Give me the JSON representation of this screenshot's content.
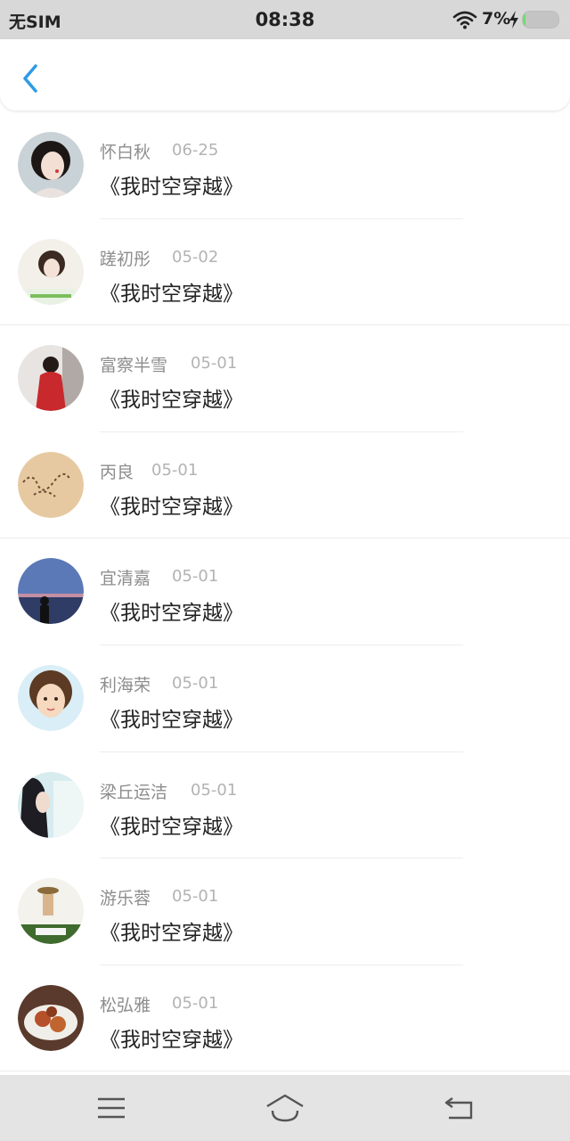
{
  "status_bar": {
    "carrier": "无SIM",
    "time": "08:38",
    "battery_percent": "7%",
    "battery_level": 0.07
  },
  "header": {
    "back_icon": "chevron-left-icon"
  },
  "colors": {
    "accent": "#2e9be6",
    "status_bar_bg": "#d8d8d8",
    "nav_bar_bg": "#e4e4e4"
  },
  "list": {
    "items": [
      {
        "name": "怀白秋",
        "date": "06-25",
        "title": "《我时空穿越》",
        "avatar": "portrait-girl"
      },
      {
        "name": "蹉初彤",
        "date": "05-02",
        "title": "《我时空穿越》",
        "avatar": "portrait-girl-sketch"
      },
      {
        "name": "富察半雪",
        "date": "05-01",
        "title": "《我时空穿越》",
        "avatar": "girl-red-dress"
      },
      {
        "name": "丙良",
        "date": "05-01",
        "title": "《我时空穿越》",
        "avatar": "sand-writing"
      },
      {
        "name": "宜清嘉",
        "date": "05-01",
        "title": "《我时空穿越》",
        "avatar": "lake-sunset"
      },
      {
        "name": "利海荣",
        "date": "05-01",
        "title": "《我时空穿越》",
        "avatar": "cartoon-boy"
      },
      {
        "name": "梁丘运洁",
        "date": "05-01",
        "title": "《我时空穿越》",
        "avatar": "girl-side-profile"
      },
      {
        "name": "游乐蓉",
        "date": "05-01",
        "title": "《我时空穿越》",
        "avatar": "girl-hat-field"
      },
      {
        "name": "松弘雅",
        "date": "05-01",
        "title": "《我时空穿越》",
        "avatar": "food-plate"
      }
    ]
  },
  "nav_bar": {
    "menu_icon": "menu-icon",
    "home_icon": "home-icon",
    "back_icon": "back-icon"
  }
}
